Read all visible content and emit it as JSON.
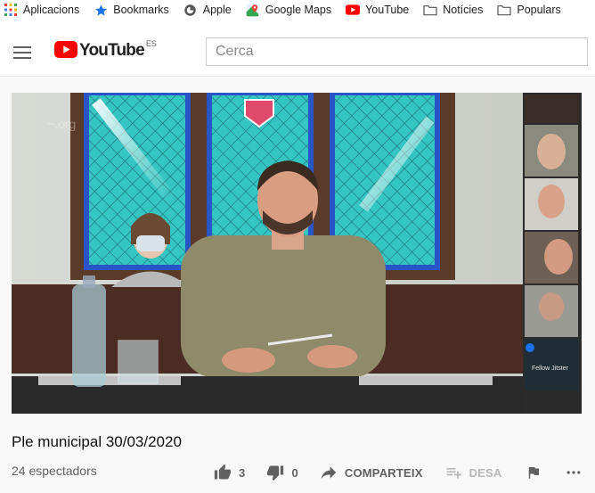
{
  "bookmarks": [
    {
      "label": "Aplicacions",
      "icon": "apps-grid-icon"
    },
    {
      "label": "Bookmarks",
      "icon": "star-icon"
    },
    {
      "label": "Apple",
      "icon": "apple-icon"
    },
    {
      "label": "Google Maps",
      "icon": "google-maps-icon"
    },
    {
      "label": "YouTube",
      "icon": "youtube-icon"
    },
    {
      "label": "Notícies",
      "icon": "folder-icon"
    },
    {
      "label": "Populars",
      "icon": "folder-icon"
    }
  ],
  "masthead": {
    "logo_text": "YouTube",
    "region": "ES",
    "search_placeholder": "Cerca"
  },
  "video": {
    "participant_caption": "Fellow Jitster"
  },
  "info": {
    "title": "Ple municipal 30/03/2020",
    "views": "24 espectadors",
    "likes": "3",
    "dislikes": "0",
    "share_label": "COMPARTEIX",
    "save_label": "DESA"
  },
  "colors": {
    "youtube_red": "#ff0000",
    "text_secondary": "#606060",
    "stained_glass": "#2ec4c6"
  }
}
